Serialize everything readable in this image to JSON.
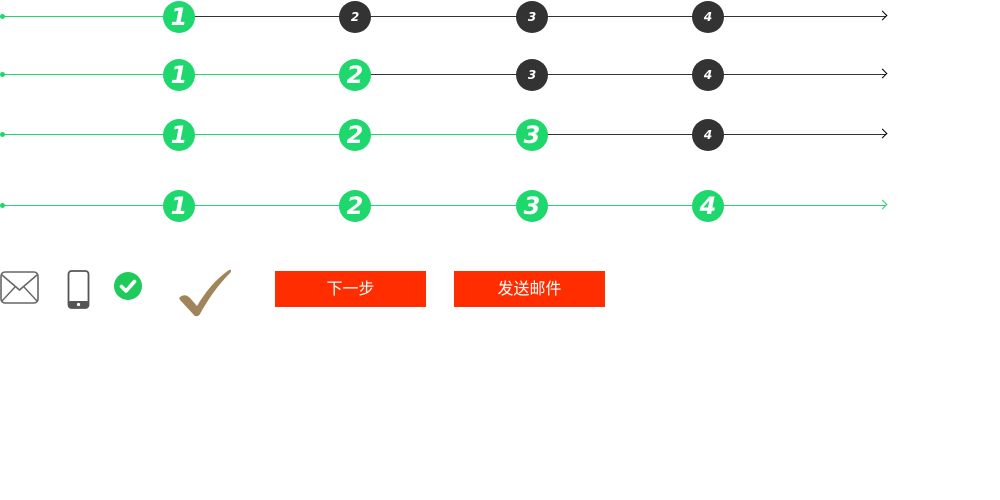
{
  "colors": {
    "active": "#1ed76d",
    "inactive": "#333333",
    "button": "#ff2d00",
    "checkmark_large": "#a0845a"
  },
  "steppers": [
    {
      "completed": 1,
      "steps": [
        "1",
        "2",
        "3",
        "4"
      ]
    },
    {
      "completed": 2,
      "steps": [
        "1",
        "2",
        "3",
        "4"
      ]
    },
    {
      "completed": 3,
      "steps": [
        "1",
        "2",
        "3",
        "4"
      ]
    },
    {
      "completed": 4,
      "steps": [
        "1",
        "2",
        "3",
        "4"
      ]
    }
  ],
  "icons": [
    "mail-icon",
    "phone-icon",
    "check-circle-icon",
    "checkmark-icon"
  ],
  "buttons": {
    "next_label": "下一步",
    "send_email_label": "发送邮件"
  }
}
